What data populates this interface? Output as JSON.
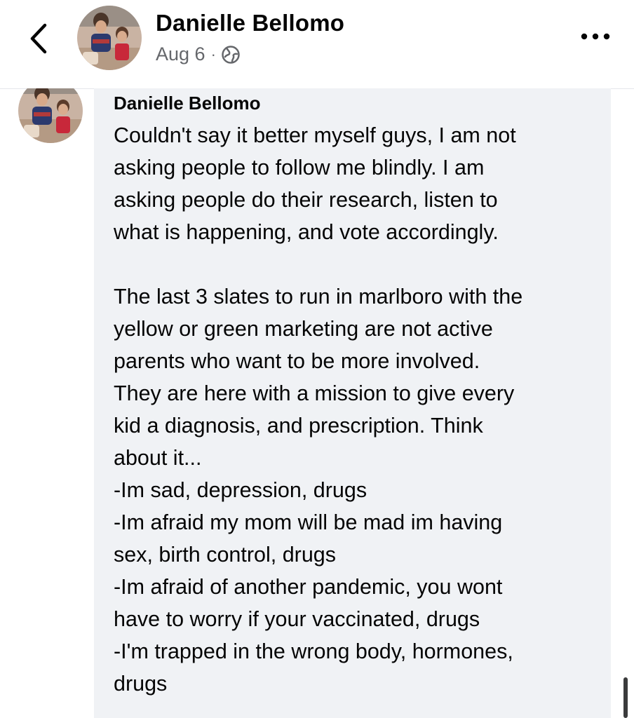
{
  "header": {
    "author_name": "Danielle Bellomo",
    "date": "Aug 6",
    "separator": "·",
    "visibility_icon": "globe-icon",
    "back_icon": "chevron-left-icon",
    "more_icon": "more-horizontal-icon"
  },
  "comment": {
    "author_name": "Danielle Bellomo",
    "lines": [
      "Couldn't say it better myself guys, I am not",
      "asking people to follow me blindly. I am",
      "asking people do their research, listen to",
      "what is happening, and vote accordingly.",
      "",
      "The last 3 slates to run in marlboro with the",
      "yellow or green marketing are not active",
      "parents who want to be more involved.",
      "They are here with a mission to give every",
      "kid a diagnosis, and prescription. Think",
      "about it...",
      "-Im sad, depression, drugs",
      "-Im afraid my mom will be mad im having",
      "sex, birth control, drugs",
      "-Im afraid of another pandemic, you wont",
      "have to worry if your vaccinated, drugs",
      "-I'm trapped in the wrong body, hormones,",
      "drugs"
    ]
  },
  "colors": {
    "bubble_background": "#f0f2f5",
    "text_primary": "#050505",
    "text_secondary": "#65676b"
  }
}
